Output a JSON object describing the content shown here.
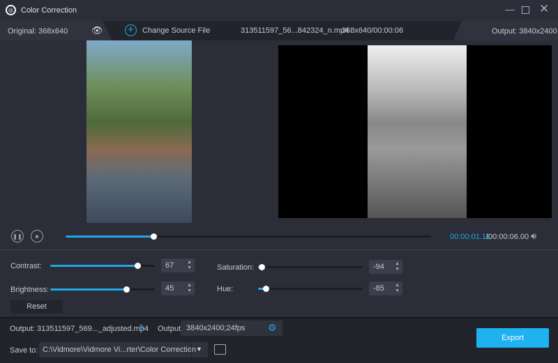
{
  "window": {
    "title": "Color Correction"
  },
  "infobar": {
    "original": "Original: 368x640",
    "change_source": "Change Source File",
    "file_name": "313511597_56...842324_n.mp4",
    "file_info": "368x640/00:00:06",
    "output": "Output: 3840x2400"
  },
  "player": {
    "current_time": "00:00:01.11",
    "total_time": "/00:00:06.00",
    "progress": 0.24
  },
  "adjust": {
    "contrast": {
      "label": "Contrast:",
      "value": "67",
      "level": 67
    },
    "brightness": {
      "label": "Brightness:",
      "value": "45",
      "level": 45
    },
    "saturation": {
      "label": "Saturation:",
      "value": "-94",
      "level": -94
    },
    "hue": {
      "label": "Hue:",
      "value": "-85",
      "level": -85
    },
    "range": [
      -100,
      100
    ],
    "reset": "Reset"
  },
  "bottom": {
    "output_label": "Output:",
    "output_file": "313511597_569..._adjusted.mp4",
    "format_label": "Output:",
    "format_value": "3840x2400;24fps",
    "save_label": "Save to:",
    "save_path": "C:\\Vidmore\\Vidmore Vi...rter\\Color Correction",
    "export": "Export"
  },
  "colors": {
    "accent": "#1fa7e6",
    "background": "#2b2d38"
  }
}
